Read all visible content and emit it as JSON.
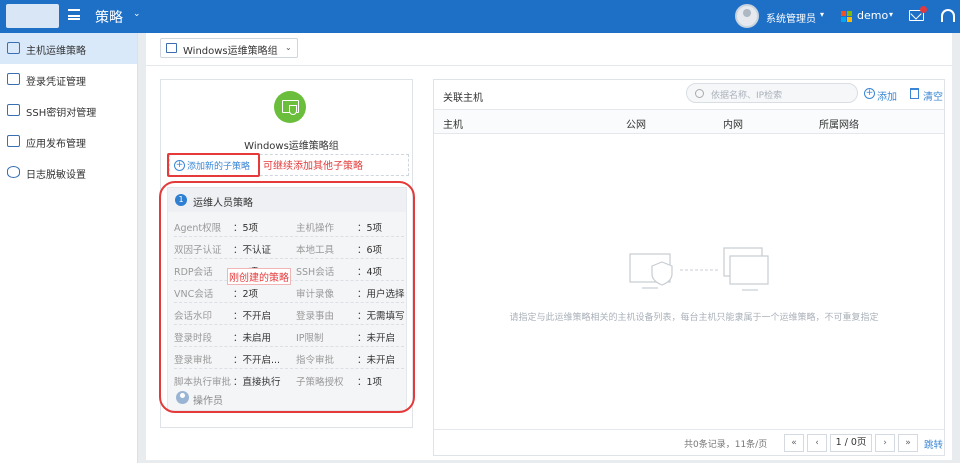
{
  "header": {
    "app_title": "策略",
    "user_name": "系统管理员",
    "tenant": "demo",
    "colors": {
      "bar": "#1e6fc6"
    }
  },
  "sidebar": {
    "items": [
      {
        "label": "主机运维策略",
        "icon": "monitor-shield-icon",
        "active": true
      },
      {
        "label": "登录凭证管理",
        "icon": "id-card-icon",
        "active": false
      },
      {
        "label": "SSH密钥对管理",
        "icon": "key-card-icon",
        "active": false
      },
      {
        "label": "应用发布管理",
        "icon": "app-window-icon",
        "active": false
      },
      {
        "label": "日志脱敏设置",
        "icon": "eye-icon",
        "active": false
      }
    ]
  },
  "toolbar": {
    "group_select": "Windows运维策略组"
  },
  "policy": {
    "name": "Windows运维策略组",
    "add_sub_label": "添加新的子策略",
    "annotation_add": "可继续添加其他子策略",
    "annotation_new": "刚创建的策略",
    "card": {
      "number": "1",
      "title": "运维人员策略",
      "rows": [
        {
          "l1": "Agent权限",
          "v1": "：5项",
          "l2": "主机操作",
          "v2": "：5项"
        },
        {
          "l1": "双因子认证",
          "v1": "：不认证",
          "l2": "本地工具",
          "v2": "：6项"
        },
        {
          "l1": "RDP会话",
          "v1": "：4项",
          "l2": "SSH会话",
          "v2": "：4项"
        },
        {
          "l1": "VNC会话",
          "v1": "：2项",
          "l2": "审计录像",
          "v2": "：用户选择"
        },
        {
          "l1": "会话水印",
          "v1": "：不开启",
          "l2": "登录事由",
          "v2": "：无需填写"
        },
        {
          "l1": "登录时段",
          "v1": "：未启用",
          "l2": "IP限制",
          "v2": "：未开启"
        },
        {
          "l1": "登录审批",
          "v1": "：不开启...",
          "l2": "指令审批",
          "v2": "：未开启"
        },
        {
          "l1": "脚本执行审批",
          "v1": "：直接执行",
          "l2": "子策略授权",
          "v2": "：1项"
        }
      ],
      "operator_label": "操作员"
    }
  },
  "hosts": {
    "title": "关联主机",
    "search_placeholder": "依据名称、IP检索",
    "add_label": "添加",
    "clear_label": "清空",
    "columns": [
      "主机",
      "公网",
      "内网",
      "所属网络"
    ],
    "empty_text": "请指定与此运维策略相关的主机设备列表，每台主机只能隶属于一个运维策略，不可重复指定",
    "pager": {
      "info": "共0条记录，11条/页",
      "first": "«",
      "prev": "‹",
      "current": "1 / 0页",
      "next": "›",
      "last": "»",
      "jump": "跳转"
    }
  }
}
